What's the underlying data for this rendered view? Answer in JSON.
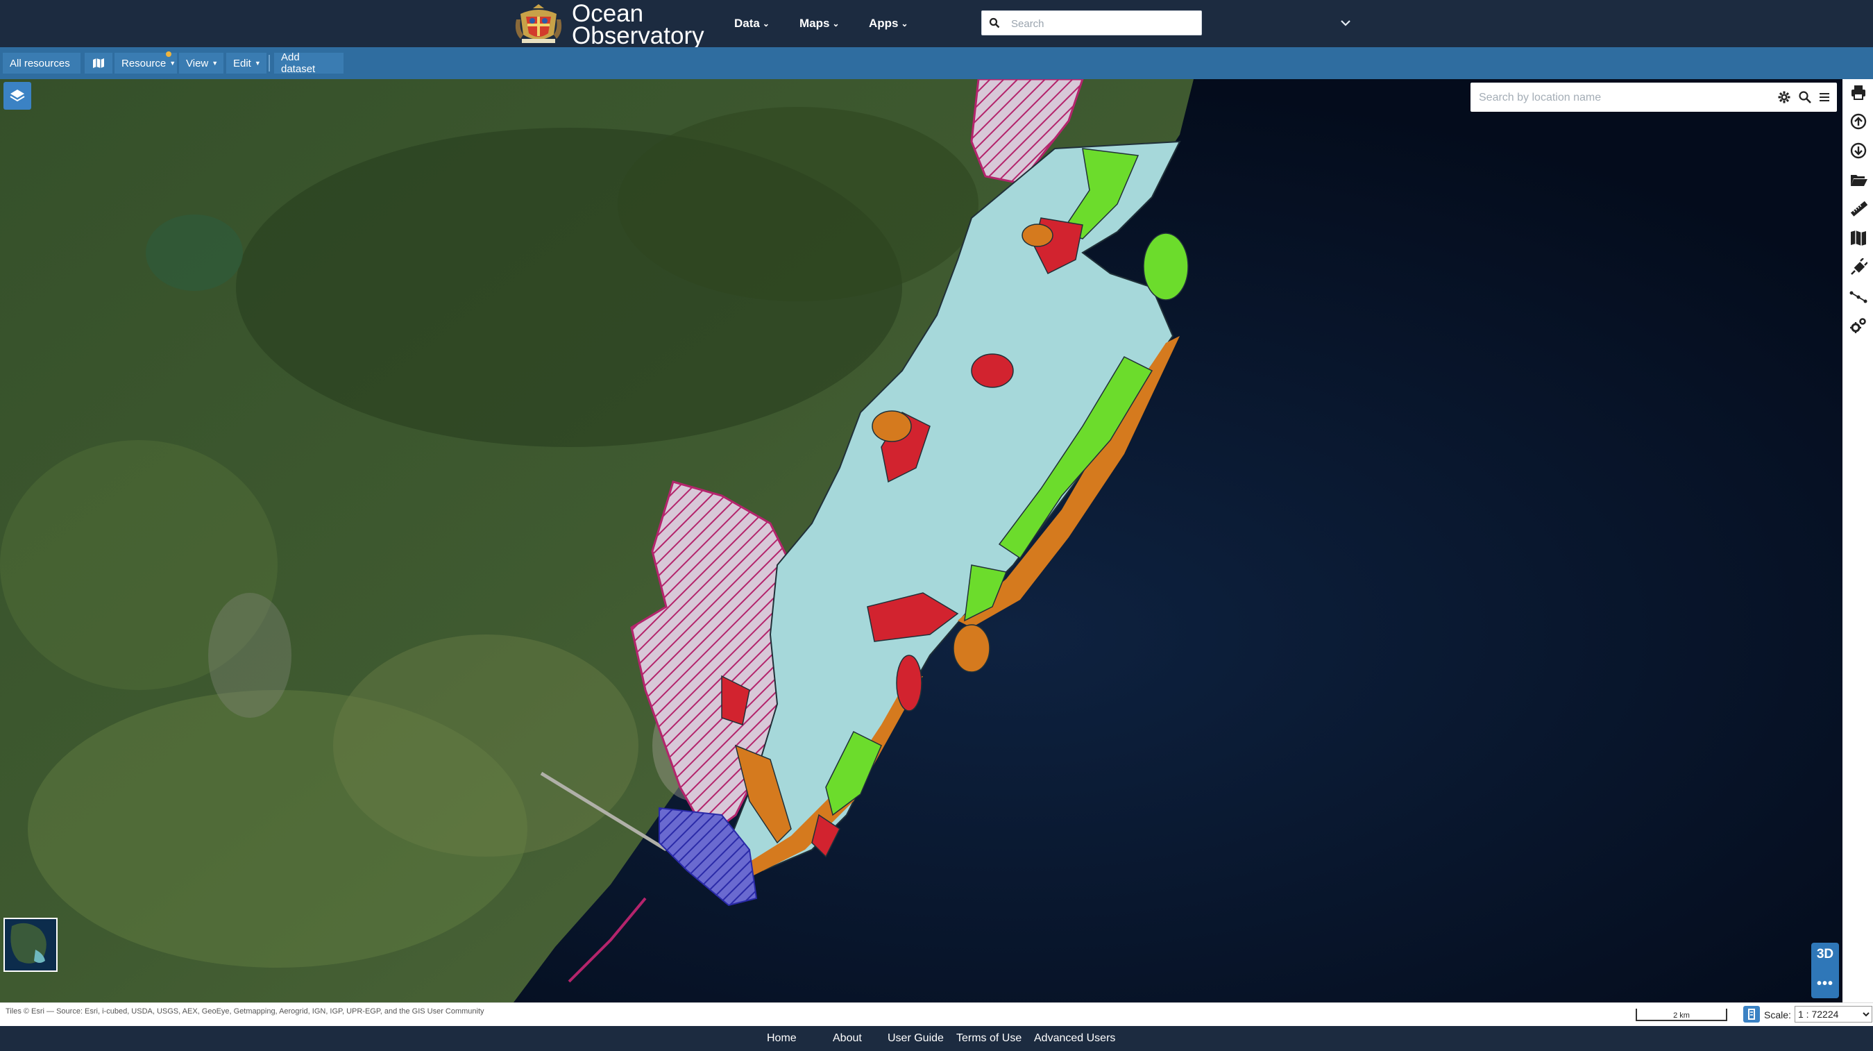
{
  "header": {
    "brand_line1": "Ocean",
    "brand_line2": "Observatory",
    "nav": [
      {
        "label": "Data"
      },
      {
        "label": "Maps"
      },
      {
        "label": "Apps"
      }
    ],
    "search_placeholder": "Search"
  },
  "toolbar": {
    "all_resources": "All resources",
    "resource": "Resource",
    "view": "View",
    "edit": "Edit",
    "add_dataset": "Add dataset"
  },
  "map": {
    "location_search_placeholder": "Search by location name",
    "btn_3d": "3D",
    "more": "•••",
    "colors": {
      "lagoon": "#a6d8da",
      "coral_red": "#d2232f",
      "seagrass_green": "#6cdc2c",
      "sand_orange": "#d57a1e",
      "protected_area": "#b4246c",
      "marine_blue": "#3c3cc8"
    },
    "tools": [
      "print-icon",
      "upload-icon",
      "download-icon",
      "folder-open-icon",
      "ruler-icon",
      "map-book-icon",
      "plug-icon",
      "draw-line-icon",
      "settings-cogs-icon"
    ]
  },
  "status": {
    "attribution": "Tiles © Esri — Source: Esri, i-cubed, USDA, USGS, AEX, GeoEye, Getmapping, Aerogrid, IGN, IGP, UPR-EGP, and the GIS User Community",
    "scale_bar": "2 km",
    "scale_label": "Scale:",
    "scale_value": "1 : 72224"
  },
  "footer": {
    "links": [
      {
        "label": "Home"
      },
      {
        "label": "About"
      },
      {
        "label": "User Guide"
      },
      {
        "label": "Terms of Use"
      },
      {
        "label": "Advanced Users"
      }
    ]
  }
}
